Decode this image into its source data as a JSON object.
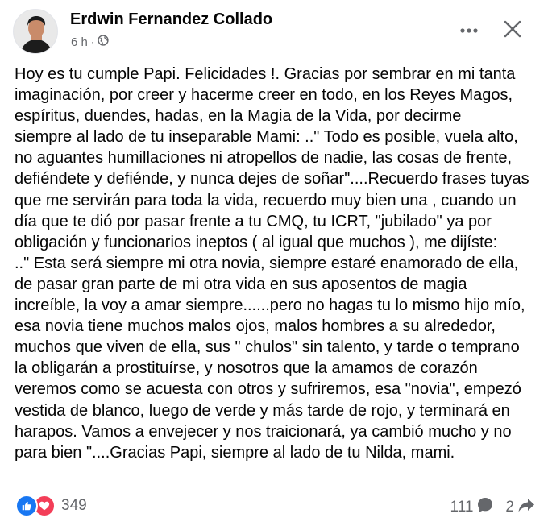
{
  "post": {
    "author": "Erdwin Fernandez Collado",
    "time": "6 h",
    "separator": "·",
    "privacy_icon": "globe-icon",
    "text": "Hoy es tu cumple Papi. Felicidades !. Gracias por sembrar en mi tanta\nimaginación, por creer y hacerme creer en todo, en los Reyes Magos,\nespíritus, duendes, hadas, en la Magia de la Vida,  por decirme\nsiempre al lado de tu inseparable Mami: ..\" Todo es posible, vuela alto,\nno aguantes humillaciones ni atropellos de nadie, las cosas de frente,\ndefiéndete y defiénde, y nunca dejes de soñar\"....Recuerdo frases tuyas\nque me servirán para toda la vida, recuerdo muy bien una , cuando un\ndía que te dió por pasar frente a tu CMQ, tu ICRT, \"jubilado\" ya por\nobligación y funcionarios ineptos ( al igual que muchos ),  me dijíste:\n..\" Esta será siempre mi otra novia, siempre estaré enamorado de ella,\nde pasar gran parte de mi otra vida en sus aposentos de magia\nincreíble, la voy a amar siempre......pero no hagas tu lo mismo hijo mío,\nesa novia tiene muchos malos ojos, malos hombres a su alrededor,\nmuchos que viven de ella, sus \" chulos\" sin talento, y tarde o temprano\nla obligarán a prostituírse, y nosotros que la amamos de corazón\nveremos como se acuesta con otros y sufriremos, esa \"novia\", empezó\nvestida de blanco,  luego de verde y más tarde de rojo, y terminará en\nharapos. Vamos a envejecer y nos traicionará, ya cambió mucho y no\npara bien \"....Gracias Papi, siempre al lado de tu  Nilda, mami."
  },
  "footer": {
    "reaction_icons": [
      "like-icon",
      "love-icon"
    ],
    "reaction_count": "349",
    "comment_count": "111",
    "share_count": "2"
  },
  "colors": {
    "text": "#050505",
    "secondary": "#65676b",
    "like": "#1877f2",
    "love": "#f33e58"
  }
}
